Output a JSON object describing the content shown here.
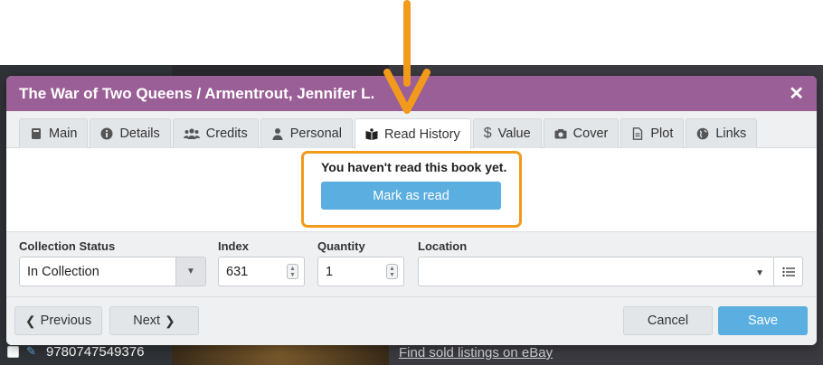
{
  "backdrop": {
    "isbn": "9780747549376",
    "link_text": "Find sold listings on eBay"
  },
  "modal": {
    "title": "The War of Two Queens / Armentrout, Jennifer L.",
    "close_symbol": "✕"
  },
  "tabs": [
    {
      "label": "Main",
      "icon": "book-icon"
    },
    {
      "label": "Details",
      "icon": "info-icon"
    },
    {
      "label": "Credits",
      "icon": "users-icon"
    },
    {
      "label": "Personal",
      "icon": "user-icon"
    },
    {
      "label": "Read History",
      "icon": "open-book-icon",
      "active": true
    },
    {
      "label": "Value",
      "icon": "dollar-icon"
    },
    {
      "label": "Cover",
      "icon": "camera-icon"
    },
    {
      "label": "Plot",
      "icon": "file-icon"
    },
    {
      "label": "Links",
      "icon": "globe-icon"
    }
  ],
  "read_history": {
    "message": "You haven't read this book yet.",
    "mark_read_label": "Mark as read"
  },
  "fields": {
    "collection_status": {
      "label": "Collection Status",
      "value": "In Collection"
    },
    "index": {
      "label": "Index",
      "value": "631"
    },
    "quantity": {
      "label": "Quantity",
      "value": "1"
    },
    "location": {
      "label": "Location",
      "value": ""
    }
  },
  "footer": {
    "previous_label": "Previous",
    "next_label": "Next",
    "cancel_label": "Cancel",
    "save_label": "Save"
  },
  "colors": {
    "header": "#9b5f97",
    "accent": "#5aaee0",
    "highlight": "#f29a1b"
  }
}
